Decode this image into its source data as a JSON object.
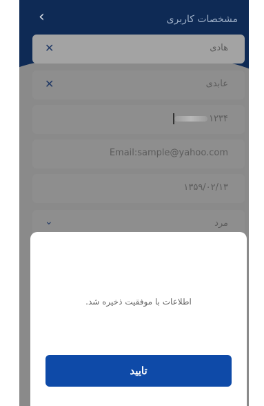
{
  "header": {
    "title": "مشخصات کاربری",
    "back_icon": "chevron-left-icon"
  },
  "form": {
    "first_name": "هادی",
    "last_name": "عابدی",
    "national_id_visible": "۱۲۳۴",
    "email": "Email:sample@yahoo.com",
    "birth_date": "۱۳۵۹/۰۲/۱۳",
    "gender": "مرد",
    "clear_icon": "close-icon",
    "dropdown_icon": "chevron-down-icon"
  },
  "dialog": {
    "message": "اطلاعات با موفقیت ذخیره شد.",
    "confirm_label": "تایید"
  },
  "colors": {
    "primary": "#0e4aa8",
    "header": "#0e2a55"
  }
}
